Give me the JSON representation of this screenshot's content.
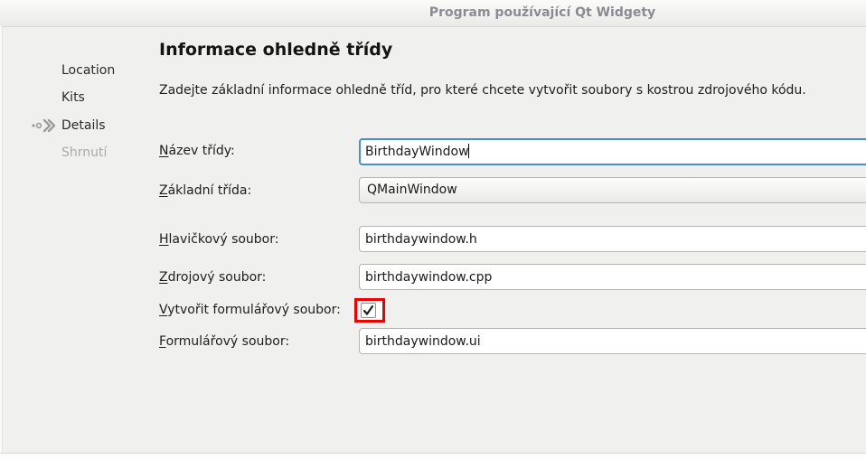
{
  "window": {
    "title": "Program používající Qt Widgety"
  },
  "sidebar": {
    "steps": [
      {
        "label": "Location",
        "state": "normal"
      },
      {
        "label": "Kits",
        "state": "normal"
      },
      {
        "label": "Details",
        "state": "current"
      },
      {
        "label": "Shrnutí",
        "state": "upcoming"
      }
    ]
  },
  "content": {
    "title": "Informace ohledně třídy",
    "description": "Zadejte základní informace ohledně tříd, pro které chcete vytvořit soubory s kostrou zdrojového kódu.",
    "fields": {
      "class_name": {
        "label_u": "N",
        "label_rest": "ázev třídy:",
        "value": "BirthdayWindow",
        "focused": true
      },
      "base_class": {
        "label_u": "Z",
        "label_rest": "ákladní třída:",
        "value": "QMainWindow"
      },
      "header_file": {
        "label_u": "H",
        "label_rest": "lavičkový soubor:",
        "value": "birthdaywindow.h"
      },
      "source_file": {
        "label_u": "Z",
        "label_rest": "drojový soubor:",
        "value": "birthdaywindow.cpp"
      },
      "create_form": {
        "label_u": "V",
        "label_rest": "ytvořit formulářový soubor:",
        "checked": true
      },
      "form_file": {
        "label_u": "F",
        "label_rest": "ormulářový soubor:",
        "value": "birthdaywindow.ui"
      }
    }
  },
  "colors": {
    "focus_accent": "#4790ce",
    "annotation_red": "#ef0000",
    "titlebar_text": "#8b8b93",
    "disabled_step_text": "#aaaaa8",
    "background": "#f0f0ee"
  }
}
